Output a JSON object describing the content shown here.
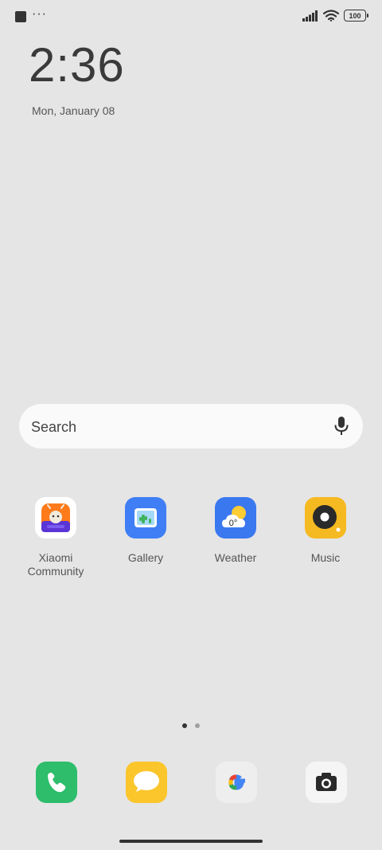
{
  "status_bar": {
    "more_indicator": "···",
    "battery_level": "100",
    "icons": [
      "notification-square-icon",
      "signal-icon",
      "wifi-icon",
      "battery-icon"
    ]
  },
  "lockscreen_clock": {
    "time": "2:36",
    "date": "Mon, January 08"
  },
  "search_bar": {
    "label": "Search",
    "icon": "microphone-icon"
  },
  "apps": [
    {
      "label": "Xiaomi\nCommunity",
      "icon": "xiaomi-community-icon"
    },
    {
      "label": "Gallery",
      "icon": "gallery-icon"
    },
    {
      "label": "Weather",
      "icon": "weather-icon",
      "badge": "0°"
    },
    {
      "label": "Music",
      "icon": "music-icon"
    }
  ],
  "page_indicator": {
    "pages": 2,
    "active": 1
  },
  "dock": [
    {
      "icon": "phone-icon"
    },
    {
      "icon": "messages-icon"
    },
    {
      "icon": "google-icon"
    },
    {
      "icon": "camera-icon"
    }
  ],
  "colors": {
    "background": "#e5e5e5",
    "gallery": "#3f7ef5",
    "weather": "#3a78f0",
    "music": "#f5b921",
    "phone": "#2dbd6b",
    "messages": "#fbc52c"
  }
}
